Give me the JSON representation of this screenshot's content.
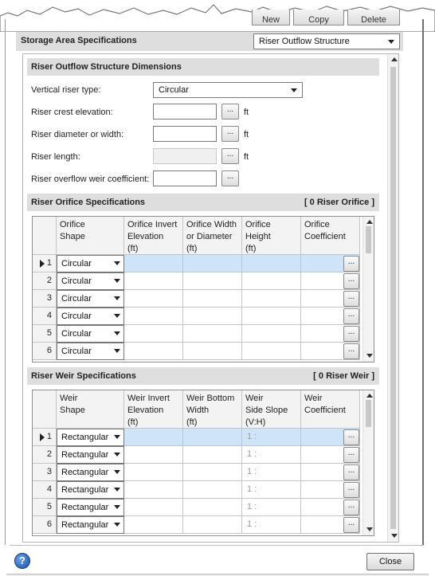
{
  "toolbar": {
    "new_label": "New",
    "copy_label": "Copy",
    "delete_label": "Delete"
  },
  "storage": {
    "title": "Storage Area Specifications",
    "selector_value": "Riser Outflow Structure"
  },
  "dimensions": {
    "title": "Riser Outflow Structure Dimensions",
    "vertical_riser_type_label": "Vertical riser type:",
    "vertical_riser_type_value": "Circular",
    "crest_label": "Riser crest elevation:",
    "diameter_label": "Riser diameter or width:",
    "length_label": "Riser length:",
    "weir_coef_label": "Riser overflow weir coefficient:",
    "unit": "ft",
    "dots": "..."
  },
  "orifice": {
    "title": "Riser Orifice Specifications",
    "count": "[ 0 Riser Orifice ]",
    "headers": [
      "Orifice\nShape",
      "Orifice Invert\nElevation\n(ft)",
      "Orifice Width\nor Diameter\n(ft)",
      "Orifice\nHeight\n(ft)",
      "Orifice\nCoefficient"
    ],
    "rows": [
      {
        "num": "1",
        "shape": "Circular"
      },
      {
        "num": "2",
        "shape": "Circular"
      },
      {
        "num": "3",
        "shape": "Circular"
      },
      {
        "num": "4",
        "shape": "Circular"
      },
      {
        "num": "5",
        "shape": "Circular"
      },
      {
        "num": "6",
        "shape": "Circular"
      }
    ]
  },
  "weir": {
    "title": "Riser Weir Specifications",
    "count": "[ 0 Riser Weir ]",
    "headers": [
      "Weir\nShape",
      "Weir Invert\nElevation\n(ft)",
      "Weir Bottom\nWidth\n(ft)",
      "Weir\nSide Slope\n(V:H)",
      "Weir\nCoefficient"
    ],
    "rows": [
      {
        "num": "1",
        "shape": "Rectangular",
        "slope": "1 :"
      },
      {
        "num": "2",
        "shape": "Rectangular",
        "slope": "1 :"
      },
      {
        "num": "3",
        "shape": "Rectangular",
        "slope": "1 :"
      },
      {
        "num": "4",
        "shape": "Rectangular",
        "slope": "1 :"
      },
      {
        "num": "5",
        "shape": "Rectangular",
        "slope": "1 :"
      },
      {
        "num": "6",
        "shape": "Rectangular",
        "slope": "1 :"
      }
    ]
  },
  "footer": {
    "help": "?",
    "close_label": "Close"
  }
}
